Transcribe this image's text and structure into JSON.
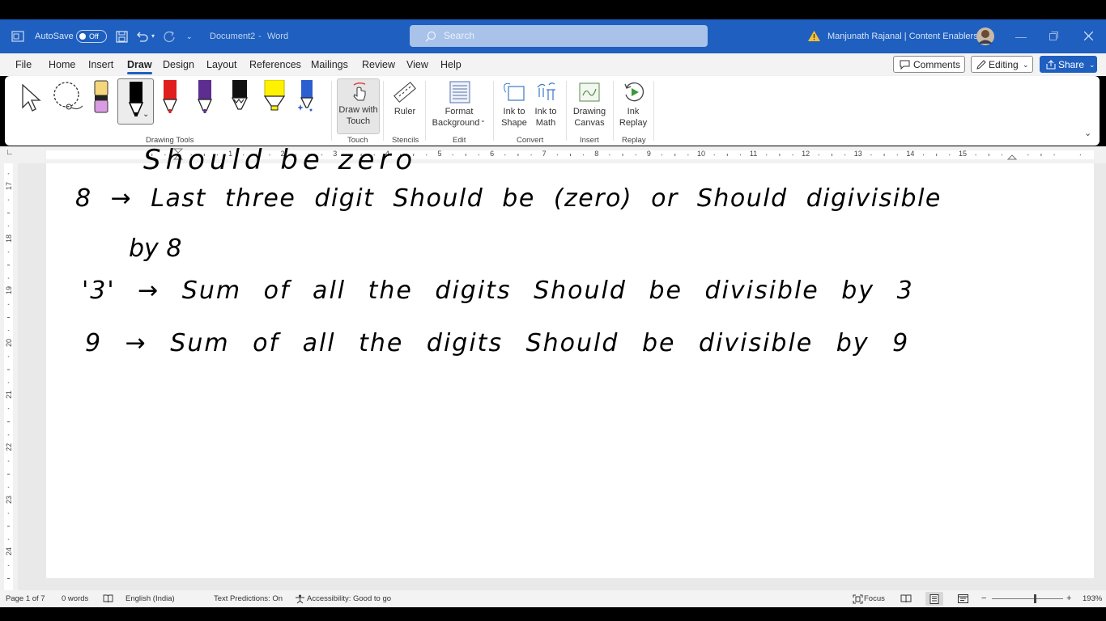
{
  "titlebar": {
    "autosave_label": "AutoSave",
    "autosave_state": "Off",
    "doc_title": "Document2",
    "separator": "-",
    "app_name": "Word",
    "search_placeholder": "Search",
    "user_name": "Manjunath Rajanal | Content Enablers"
  },
  "menu": {
    "tabs": [
      "File",
      "Home",
      "Insert",
      "Draw",
      "Design",
      "Layout",
      "References",
      "Mailings",
      "Review",
      "View",
      "Help"
    ],
    "active_tab": "Draw",
    "comments_label": "Comments",
    "editing_label": "Editing",
    "share_label": "Share"
  },
  "ribbon": {
    "groups": {
      "drawing_tools": "Drawing Tools",
      "touch": "Touch",
      "stencils": "Stencils",
      "edit": "Edit",
      "convert": "Convert",
      "insert": "Insert",
      "replay": "Replay"
    },
    "buttons": {
      "draw_with_touch": [
        "Draw with",
        "Touch"
      ],
      "ruler": "Ruler",
      "format_background": [
        "Format",
        "Background"
      ],
      "ink_to_shape": [
        "Ink to",
        "Shape"
      ],
      "ink_to_math": [
        "Ink to",
        "Math"
      ],
      "drawing_canvas": [
        "Drawing",
        "Canvas"
      ],
      "ink_replay": [
        "Ink",
        "Replay"
      ]
    },
    "pens": [
      {
        "name": "highlighter-pink",
        "color": "#f4a0d6"
      },
      {
        "name": "black-pen-selected",
        "color": "#000000"
      },
      {
        "name": "red-pen",
        "color": "#e01e1e"
      },
      {
        "name": "purple-pen",
        "color": "#5b2e8f"
      },
      {
        "name": "black-pen",
        "color": "#111111"
      },
      {
        "name": "yellow-highlighter",
        "color": "#fff200"
      },
      {
        "name": "galaxy-pen",
        "color": "#2c5fcf"
      }
    ]
  },
  "ruler": {
    "h_numbers": [
      "1",
      "2",
      "3",
      "4",
      "5",
      "6",
      "7",
      "8",
      "9",
      "10",
      "11",
      "12",
      "13",
      "14",
      "15"
    ],
    "v_numbers": [
      "17",
      "18",
      "19",
      "20",
      "21",
      "22",
      "23",
      "24"
    ]
  },
  "document": {
    "ink_lines": [
      "Should be zero",
      "8 → Last three digit Should be (zero) or Should digivisible",
      "by 8",
      "'3' → Sum of all the digits Should be divisible by 3",
      "9 → Sum of all the digits Should be divisible by 9"
    ]
  },
  "statusbar": {
    "page": "Page 1 of 7",
    "words": "0 words",
    "language": "English (India)",
    "text_predictions": "Text Predictions: On",
    "accessibility": "Accessibility: Good to go",
    "focus": "Focus",
    "zoom_minus": "−",
    "zoom_plus": "+",
    "zoom": "193%"
  },
  "colors": {
    "title_blue": "#1e5fbf",
    "ribbon_bg": "#ffffff",
    "ink": "#000000"
  }
}
